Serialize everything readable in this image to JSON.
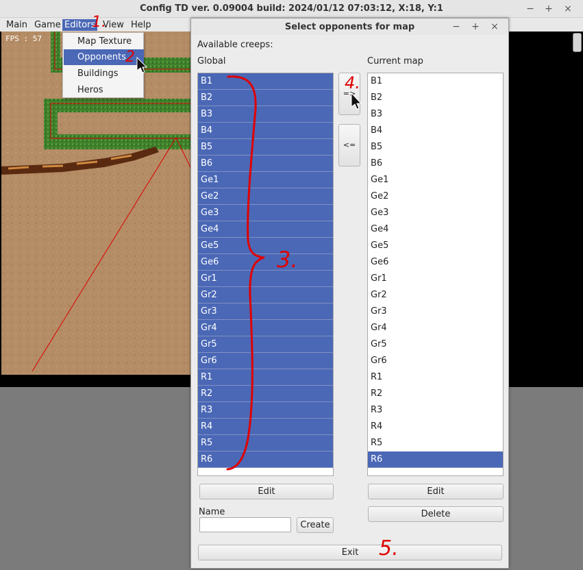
{
  "main": {
    "title": "Config TD ver. 0.09004 build: 2024/01/12  07:03:12, X:18, Y:1",
    "controls": {
      "minimize": "−",
      "maximize": "+",
      "close": "×"
    },
    "menu": [
      "Main",
      "Game",
      "Editors",
      "View",
      "Help"
    ],
    "fps": "FPS : 57",
    "editors_menu": [
      "Map Texture",
      "Opponents",
      "Buildings",
      "Heros"
    ]
  },
  "dialog": {
    "title": "Select opponents for map",
    "controls": {
      "minimize": "−",
      "maximize": "+",
      "close": "×"
    },
    "available_label": "Available creeps:",
    "global_label": "Global",
    "current_label": "Current map",
    "global_items": [
      "B1",
      "B2",
      "B3",
      "B4",
      "B5",
      "B6",
      "Ge1",
      "Ge2",
      "Ge3",
      "Ge4",
      "Ge5",
      "Ge6",
      "Gr1",
      "Gr2",
      "Gr3",
      "Gr4",
      "Gr5",
      "Gr6",
      "R1",
      "R2",
      "R3",
      "R4",
      "R5",
      "R6"
    ],
    "current_items": [
      "B1",
      "B2",
      "B3",
      "B4",
      "B5",
      "B6",
      "Ge1",
      "Ge2",
      "Ge3",
      "Ge4",
      "Ge5",
      "Ge6",
      "Gr1",
      "Gr2",
      "Gr3",
      "Gr4",
      "Gr5",
      "Gr6",
      "R1",
      "R2",
      "R3",
      "R4",
      "R5",
      "R6"
    ],
    "current_selected": "R6",
    "add_button": "=>",
    "remove_button": "<=",
    "global_edit": "Edit",
    "current_edit": "Edit",
    "delete": "Delete",
    "name_label": "Name",
    "name_value": "",
    "create": "Create",
    "exit": "Exit"
  },
  "annotations": [
    "1.",
    "2",
    "3.",
    "4.",
    "5."
  ],
  "colors": {
    "selection": "#4b68b6",
    "annotation": "#e00000",
    "sand": "#b48c65",
    "grass": "#3a7a2a"
  }
}
